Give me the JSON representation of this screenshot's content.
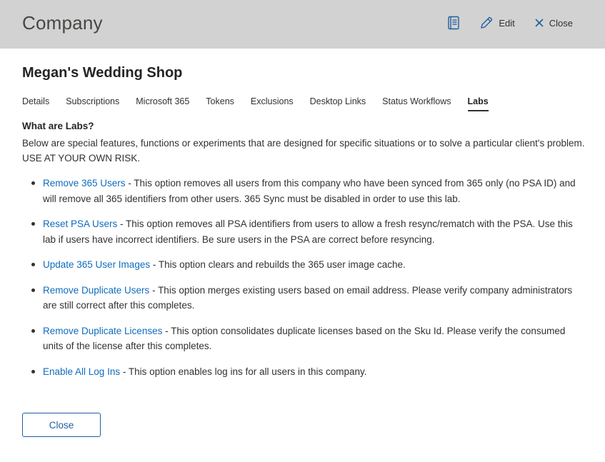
{
  "header": {
    "title": "Company",
    "edit_label": "Edit",
    "close_label": "Close",
    "accent_color": "#1f5f9e"
  },
  "company": {
    "name": "Megan's Wedding Shop"
  },
  "tabs": [
    {
      "label": "Details"
    },
    {
      "label": "Subscriptions"
    },
    {
      "label": "Microsoft 365"
    },
    {
      "label": "Tokens"
    },
    {
      "label": "Exclusions"
    },
    {
      "label": "Desktop Links"
    },
    {
      "label": "Status Workflows"
    },
    {
      "label": "Labs",
      "active": true
    }
  ],
  "labs": {
    "title": "What are Labs?",
    "intro": "Below are special features, functions or experiments that are designed for specific situations or to solve a particular client's problem. USE AT YOUR OWN RISK.",
    "items": [
      {
        "link": "Remove 365 Users",
        "desc": " - This option removes all users from this company who have been synced from 365 only (no PSA ID) and will remove all 365 identifiers from other users. 365 Sync must be disabled in order to use this lab."
      },
      {
        "link": "Reset PSA Users",
        "desc": " - This option removes all PSA identifiers from users to allow a fresh resync/rematch with the PSA. Use this lab if users have incorrect identifiers. Be sure users in the PSA are correct before resyncing."
      },
      {
        "link": "Update 365 User Images",
        "desc": " - This option clears and rebuilds the 365 user image cache."
      },
      {
        "link": "Remove Duplicate Users",
        "desc": " - This option merges existing users based on email address. Please verify company administrators are still correct after this completes."
      },
      {
        "link": "Remove Duplicate Licenses",
        "desc": " - This option consolidates duplicate licenses based on the Sku Id. Please verify the consumed units of the license after this completes."
      },
      {
        "link": "Enable All Log Ins",
        "desc": " - This option enables log ins for all users in this company."
      }
    ]
  },
  "footer": {
    "close_label": "Close"
  },
  "icons": {
    "book": "book-icon",
    "edit": "pencil-icon",
    "close": "close-icon"
  }
}
